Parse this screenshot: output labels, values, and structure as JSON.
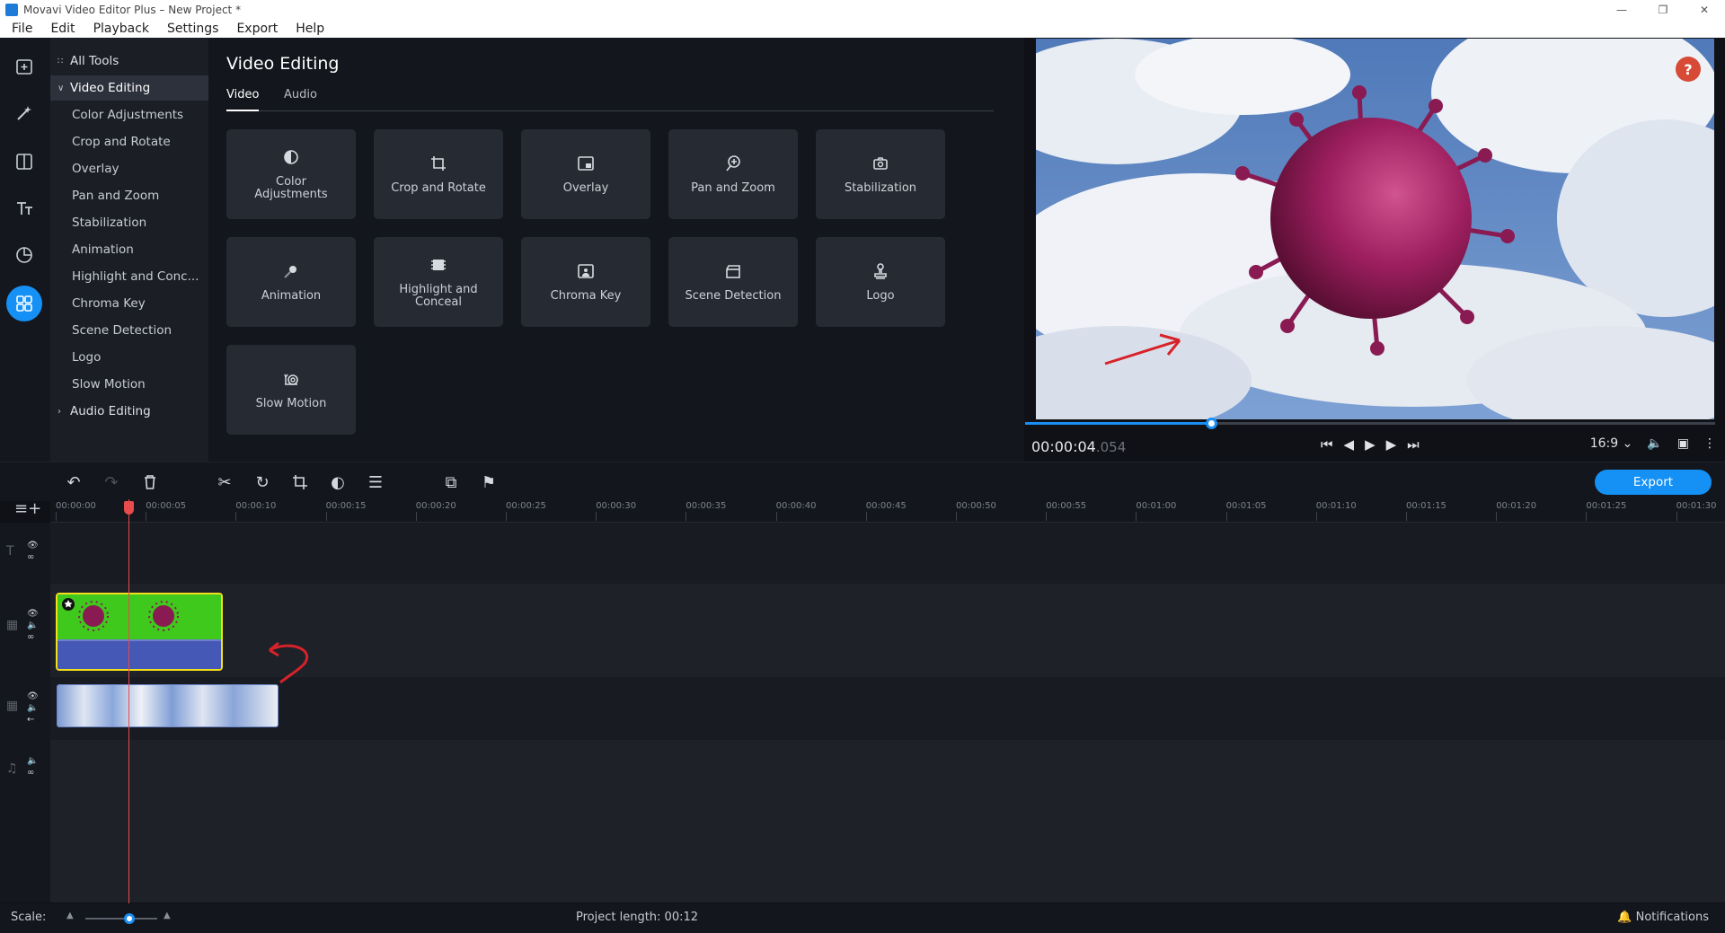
{
  "window": {
    "title": "Movavi Video Editor Plus – New Project *"
  },
  "menu": [
    "File",
    "Edit",
    "Playback",
    "Settings",
    "Export",
    "Help"
  ],
  "tools": {
    "all_tools": "All Tools",
    "category": "Video Editing",
    "items": [
      "Color Adjustments",
      "Crop and Rotate",
      "Overlay",
      "Pan and Zoom",
      "Stabilization",
      "Animation",
      "Highlight and Conc...",
      "Chroma Key",
      "Scene Detection",
      "Logo",
      "Slow Motion"
    ],
    "audio_category": "Audio Editing"
  },
  "panel": {
    "title": "Video Editing",
    "tabs": [
      "Video",
      "Audio"
    ],
    "tiles": [
      "Color\nAdjustments",
      "Crop and Rotate",
      "Overlay",
      "Pan and Zoom",
      "Stabilization",
      "Animation",
      "Highlight and\nConceal",
      "Chroma Key",
      "Scene Detection",
      "Logo",
      "Slow Motion"
    ]
  },
  "player": {
    "time": "00:00:04",
    "time_ms": ".054",
    "aspect": "16:9",
    "progress_fraction": 0.27,
    "help": "?"
  },
  "timeline": {
    "export_label": "Export",
    "ruler": [
      "00:00:00",
      "00:00:05",
      "00:00:10",
      "00:00:15",
      "00:00:20",
      "00:00:25",
      "00:00:30",
      "00:00:35",
      "00:00:40",
      "00:00:45",
      "00:00:50",
      "00:00:55",
      "00:01:00",
      "00:01:05",
      "00:01:10",
      "00:01:15",
      "00:01:20",
      "00:01:25",
      "00:01:30"
    ]
  },
  "status": {
    "scale_label": "Scale:",
    "project_length": "Project length:  00:12",
    "notifications": "Notifications"
  },
  "colors": {
    "accent": "#1591f5",
    "playhead": "#e84b4b",
    "clip_green": "#3ec91c",
    "clip_border": "#f2e01a",
    "help": "#d64a36"
  }
}
